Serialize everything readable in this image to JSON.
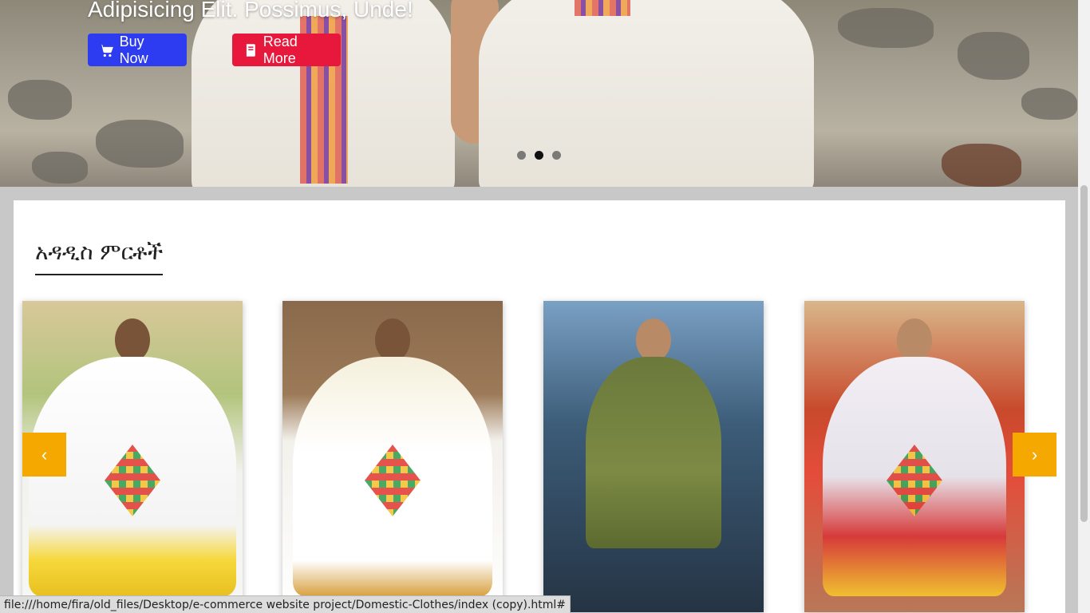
{
  "hero": {
    "title": "Adipisicing Elit. Possimus, Unde!",
    "buy_label": "Buy Now",
    "buy_icon": "cart-icon",
    "read_label": "Read More",
    "read_icon": "book-icon",
    "slide_count": 3,
    "active_slide": 2,
    "colors": {
      "buy": "#2d3cf0",
      "read": "#e8183c"
    }
  },
  "section": {
    "title": "አዳዲስ ምርቶች"
  },
  "carousel": {
    "prev_label": "‹",
    "next_label": "›",
    "arrow_color": "#f5a800",
    "products": [
      {
        "image": "white-embroidered-dress-photo"
      },
      {
        "image": "white-cross-pattern-dress-photo"
      },
      {
        "image": "green-dress-photo"
      },
      {
        "image": "white-red-pattern-dress-photo"
      }
    ]
  },
  "status_bar": {
    "url": "file:///home/fira/old_files/Desktop/e-commerce website project/Domestic-Clothes/index (copy).html#"
  }
}
